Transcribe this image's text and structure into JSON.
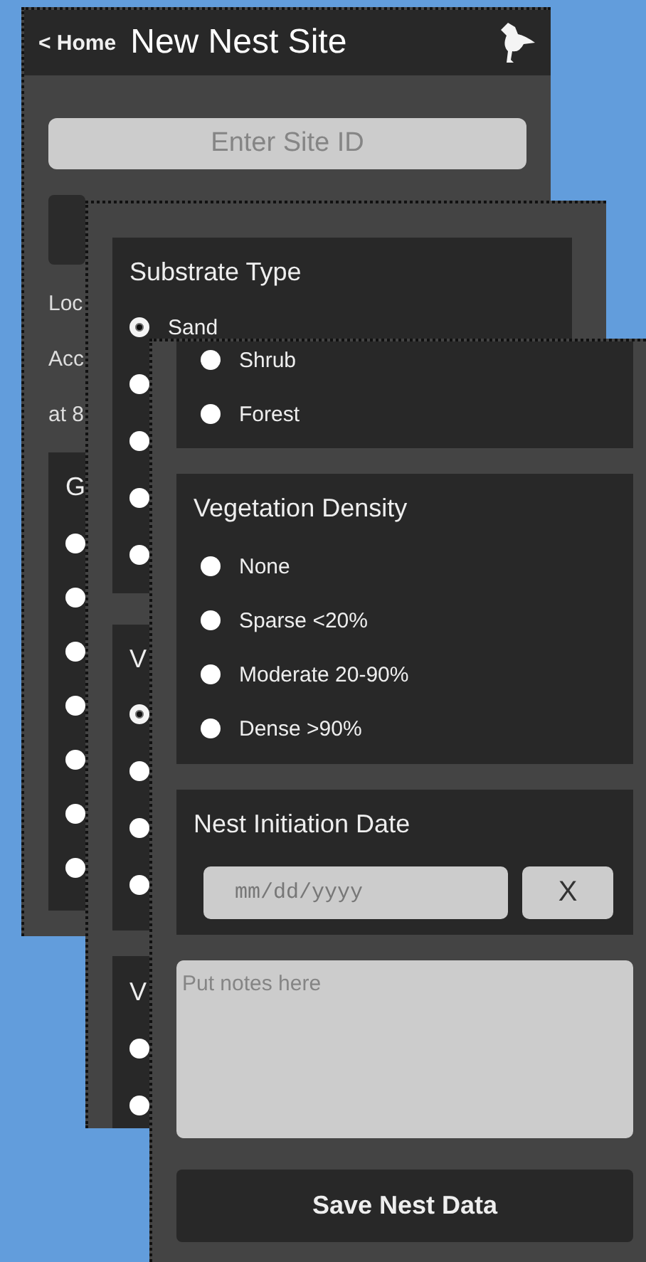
{
  "screens": [
    {
      "header": {
        "back": "< Home",
        "title": "New Nest Site"
      },
      "site_id": {
        "placeholder": "Enter Site ID"
      },
      "lines": [
        "Loc",
        "Acc",
        "at 8"
      ],
      "groups": [
        {
          "heading": "G",
          "options": [
            {
              "selected": false
            },
            {
              "selected": false
            },
            {
              "selected": false
            },
            {
              "selected": false
            },
            {
              "selected": false
            },
            {
              "selected": false
            },
            {
              "selected": false
            }
          ]
        }
      ]
    },
    {
      "groups": [
        {
          "heading": "Substrate Type",
          "options": [
            {
              "label": "Sand",
              "selected": true
            },
            {
              "selected": false
            },
            {
              "selected": false
            },
            {
              "selected": false
            },
            {
              "selected": false
            }
          ]
        },
        {
          "heading": "V",
          "options": [
            {
              "selected": true
            },
            {
              "selected": false
            },
            {
              "selected": false
            },
            {
              "selected": false
            }
          ]
        },
        {
          "heading": "V",
          "options": [
            {
              "selected": false
            },
            {
              "selected": false
            }
          ]
        }
      ]
    },
    {
      "groups": [
        {
          "options": [
            {
              "label": "Shrub",
              "selected": false
            },
            {
              "label": "Forest",
              "selected": false
            }
          ]
        },
        {
          "heading": "Vegetation Density",
          "options": [
            {
              "label": "None",
              "selected": false
            },
            {
              "label": "Sparse <20%",
              "selected": false
            },
            {
              "label": "Moderate 20-90%",
              "selected": false
            },
            {
              "label": "Dense >90%",
              "selected": false
            }
          ]
        }
      ],
      "date": {
        "label": "Nest Initiation Date",
        "placeholder": "mm/dd/yyyy",
        "clear": "X"
      },
      "notes": {
        "placeholder": "Put notes here"
      },
      "save": "Save Nest Data"
    }
  ]
}
